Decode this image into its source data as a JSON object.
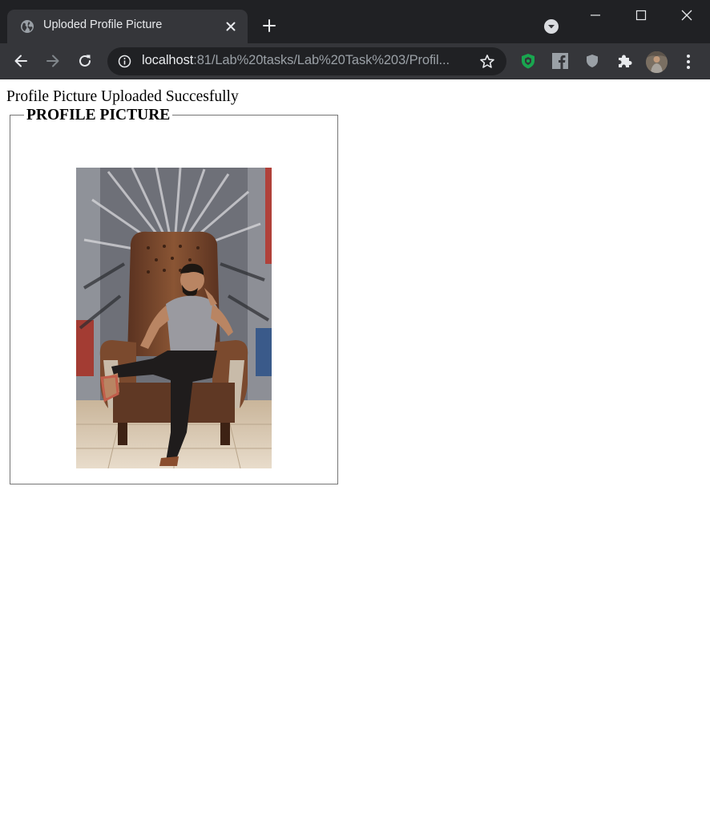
{
  "browser": {
    "tab": {
      "title": "Uploded Profile Picture",
      "favicon": "globe-icon",
      "close_icon": "close-icon"
    },
    "new_tab_icon": "plus-icon",
    "tab_search_icon": "chevron-down-circle-icon",
    "window_controls": [
      "minimize-icon",
      "maximize-icon",
      "close-icon"
    ],
    "toolbar": {
      "back_icon": "arrow-left-icon",
      "forward_icon": "arrow-right-icon",
      "reload_icon": "reload-icon",
      "address": {
        "security_icon": "info-icon",
        "host": "localhost",
        "path": ":81/Lab%20tasks/Lab%20Task%203/Profil...",
        "bookmark_icon": "star-icon"
      },
      "extensions": [
        "adblock-icon",
        "facebook-icon",
        "shield-icon",
        "puzzle-icon"
      ],
      "profile_icon": "avatar",
      "menu_icon": "more-vertical-icon"
    },
    "colors": {
      "tabstrip": "#202124",
      "toolbar": "#35363a",
      "adblock_green": "#19a64f"
    }
  },
  "page": {
    "message": "Profile Picture Uploaded Succesfully",
    "fieldset": {
      "legend": "PROFILE PICTURE",
      "image": "profile-photo"
    }
  }
}
